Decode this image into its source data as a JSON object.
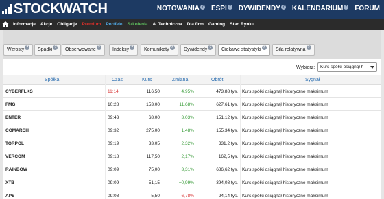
{
  "header": {
    "logo_text": "STOCKWATCH",
    "nav": [
      {
        "label": "NOTOWANIA"
      },
      {
        "label": "ESPI"
      },
      {
        "label": "DYWIDENDY"
      },
      {
        "label": "KALENDARIUM"
      },
      {
        "label": "FORUM"
      }
    ]
  },
  "subnav": {
    "items": [
      {
        "label": "Informacje",
        "color": "white"
      },
      {
        "label": "Akcje",
        "color": "white"
      },
      {
        "label": "Obligacje",
        "color": "white"
      },
      {
        "label": "Premium",
        "color": "red"
      },
      {
        "label": "Portfele",
        "color": "blue"
      },
      {
        "label": "Szkolenia",
        "color": "green"
      },
      {
        "label": "A. Techniczna",
        "color": "white"
      },
      {
        "label": "Dla firm",
        "color": "white"
      },
      {
        "label": "Gaming",
        "color": "white"
      },
      {
        "label": "Stan Rynku",
        "color": "white"
      }
    ]
  },
  "tabs": [
    {
      "label": "Wzrosty",
      "help": true
    },
    {
      "label": "Spadki",
      "help": true
    },
    {
      "label": "Obserwowane",
      "help": true
    },
    {
      "label": "Indeksy",
      "help": true
    },
    {
      "label": "Komunikaty",
      "help": true
    },
    {
      "label": "Dywidendy",
      "help": true
    },
    {
      "label": "Ciekawe statystyki",
      "help": true,
      "active": true
    },
    {
      "label": "Siła relatywna",
      "help": true
    }
  ],
  "selector": {
    "label": "Wybierz:",
    "value": "Kurs spółki osiągnął h"
  },
  "table": {
    "headers": {
      "name": "Spółka",
      "time": "Czas",
      "price": "Kurs",
      "change": "Zmiana",
      "turnover": "Obrót",
      "signal": "Sygnał"
    },
    "rows": [
      {
        "name": "CYBERFLKS",
        "time": "11:14",
        "price": "116,50",
        "change": "+4,95%",
        "turnover": "473,88 tys.",
        "signal": "Kurs spółki osiągnął historyczne maksimum",
        "dir": "pos",
        "time_red": true
      },
      {
        "name": "FMG",
        "time": "10:28",
        "price": "153,00",
        "change": "+11,68%",
        "turnover": "627,61 tys.",
        "signal": "Kurs spółki osiągnął historyczne maksimum",
        "dir": "pos"
      },
      {
        "name": "ENTER",
        "time": "09:43",
        "price": "68,00",
        "change": "+3,03%",
        "turnover": "151,12 tys.",
        "signal": "Kurs spółki osiągnął historyczne maksimum",
        "dir": "pos"
      },
      {
        "name": "COMARCH",
        "time": "09:32",
        "price": "275,00",
        "change": "+1,48%",
        "turnover": "155,34 tys.",
        "signal": "Kurs spółki osiągnął historyczne maksimum",
        "dir": "pos"
      },
      {
        "name": "TORPOL",
        "time": "09:19",
        "price": "33,05",
        "change": "+2,32%",
        "turnover": "331,2 tys.",
        "signal": "Kurs spółki osiągnął historyczne maksimum",
        "dir": "pos"
      },
      {
        "name": "VERCOM",
        "time": "09:18",
        "price": "117,50",
        "change": "+2,17%",
        "turnover": "162,5 tys.",
        "signal": "Kurs spółki osiągnął historyczne maksimum",
        "dir": "pos"
      },
      {
        "name": "RAINBOW",
        "time": "09:09",
        "price": "75,00",
        "change": "+3,31%",
        "turnover": "686,62 tys.",
        "signal": "Kurs spółki osiągnął historyczne maksimum",
        "dir": "pos"
      },
      {
        "name": "XTB",
        "time": "09:09",
        "price": "51,15",
        "change": "+0,99%",
        "turnover": "394,08 tys.",
        "signal": "Kurs spółki osiągnął historyczne maksimum",
        "dir": "pos"
      },
      {
        "name": "APS",
        "time": "09:08",
        "price": "5,50",
        "change": "-6,78%",
        "turnover": "24,14 tys.",
        "signal": "Kurs spółki osiągnął historyczne maksimum",
        "dir": "neg"
      }
    ]
  },
  "colors": {
    "header_bg": "#1d3a63",
    "subnav_bg": "#2b2b2b",
    "positive": "#3a9c3a",
    "negative": "#d83a3a",
    "header_text": "#2a6db0"
  }
}
